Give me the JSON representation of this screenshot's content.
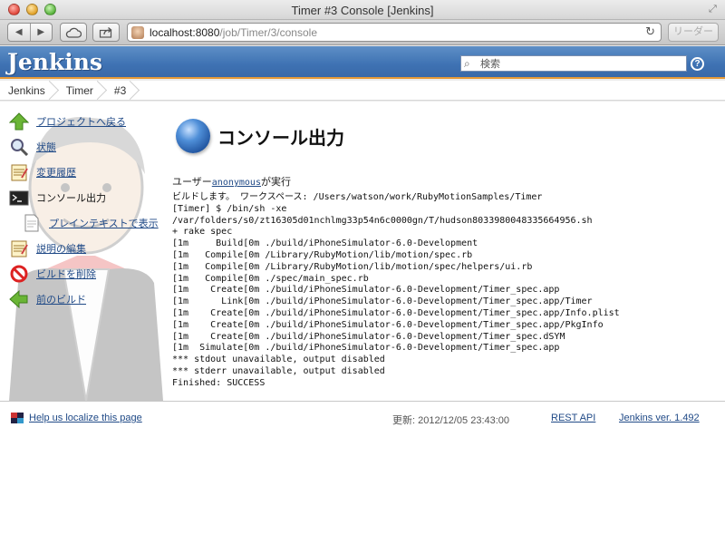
{
  "window": {
    "title": "Timer #3 Console [Jenkins]"
  },
  "browser": {
    "back_icon": "back-arrow-icon",
    "forward_icon": "forward-arrow-icon",
    "url_host": "localhost:8080",
    "url_path": "/job/Timer/3/console",
    "reader_label": "リーダー"
  },
  "header": {
    "logo": "Jenkins",
    "search_placeholder": "検索",
    "help_label": "?",
    "brand_color": "#3e72b3",
    "accent_color": "#e79a36"
  },
  "breadcrumb": [
    "Jenkins",
    "Timer",
    "#3"
  ],
  "sidebar": {
    "items": [
      {
        "label": "プロジェクトへ戻る",
        "icon": "up-arrow-icon"
      },
      {
        "label": "状態",
        "icon": "magnifier-icon"
      },
      {
        "label": "変更履歴",
        "icon": "notepad-icon"
      },
      {
        "label": "コンソール出力",
        "icon": "terminal-icon"
      },
      {
        "label": "プレインテキストで表示",
        "icon": "document-icon"
      },
      {
        "label": "説明の編集",
        "icon": "notepad-icon"
      },
      {
        "label": "ビルドを削除",
        "icon": "no-entry-icon"
      },
      {
        "label": "前のビルド",
        "icon": "left-arrow-icon"
      }
    ]
  },
  "main": {
    "heading": "コンソール出力",
    "started_prefix": "ユーザー",
    "started_user": "anonymous",
    "started_suffix": "が実行",
    "console_text": "ビルドします。 ワークスペース: /Users/watson/work/RubyMotionSamples/Timer\n[Timer] $ /bin/sh -xe\n/var/folders/s0/zt16305d01nchlmg33p54n6c0000gn/T/hudson8033980048335664956.sh\n+ rake spec\n[1m     Build[0m ./build/iPhoneSimulator-6.0-Development\n[1m   Compile[0m /Library/RubyMotion/lib/motion/spec.rb\n[1m   Compile[0m /Library/RubyMotion/lib/motion/spec/helpers/ui.rb\n[1m   Compile[0m ./spec/main_spec.rb\n[1m    Create[0m ./build/iPhoneSimulator-6.0-Development/Timer_spec.app\n[1m      Link[0m ./build/iPhoneSimulator-6.0-Development/Timer_spec.app/Timer\n[1m    Create[0m ./build/iPhoneSimulator-6.0-Development/Timer_spec.app/Info.plist\n[1m    Create[0m ./build/iPhoneSimulator-6.0-Development/Timer_spec.app/PkgInfo\n[1m    Create[0m ./build/iPhoneSimulator-6.0-Development/Timer_spec.dSYM\n[1m  Simulate[0m ./build/iPhoneSimulator-6.0-Development/Timer_spec.app\n*** stdout unavailable, output disabled\n*** stderr unavailable, output disabled\nFinished: SUCCESS"
  },
  "footer": {
    "localize_label": "Help us localize this page",
    "updated": "更新: 2012/12/05 23:43:00",
    "rest_api": "REST API",
    "version": "Jenkins ver. 1.492"
  }
}
